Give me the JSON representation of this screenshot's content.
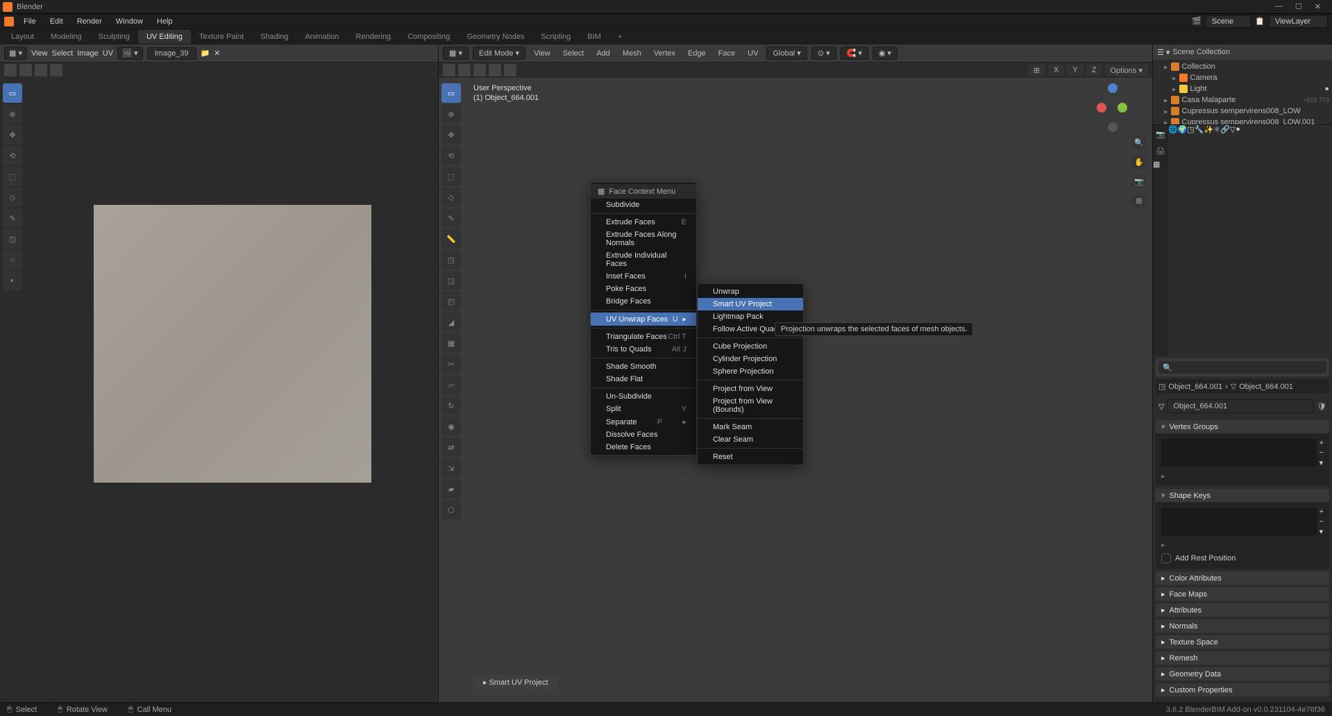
{
  "titlebar": {
    "title": "Blender"
  },
  "menubar": {
    "items": [
      "File",
      "Edit",
      "Render",
      "Window",
      "Help"
    ],
    "scene_label": "Scene",
    "viewlayer_label": "ViewLayer"
  },
  "workspace_tabs": {
    "items": [
      "Layout",
      "Modeling",
      "Sculpting",
      "UV Editing",
      "Texture Paint",
      "Shading",
      "Animation",
      "Rendering",
      "Compositing",
      "Geometry Nodes",
      "Scripting",
      "BIM",
      "+"
    ],
    "active": "UV Editing"
  },
  "uv": {
    "header_items": [
      "View",
      "Select",
      "Image",
      "UV"
    ],
    "image_name": "Image_39"
  },
  "viewport": {
    "mode": "Edit Mode",
    "menus": [
      "View",
      "Select",
      "Add",
      "Mesh",
      "Vertex",
      "Edge",
      "Face",
      "UV"
    ],
    "orientation": "Global",
    "overlay": {
      "line1": "User Perspective",
      "line2": "(1) Object_664.001"
    },
    "xyz_btns": [
      "X",
      "Y",
      "Z"
    ],
    "options_label": "Options",
    "status_label": "Smart UV Project"
  },
  "context_menu": {
    "title": "Face Context Menu",
    "items": [
      {
        "label": "Subdivide"
      },
      {
        "sep": true
      },
      {
        "label": "Extrude Faces",
        "shortcut": "E"
      },
      {
        "label": "Extrude Faces Along Normals"
      },
      {
        "label": "Extrude Individual Faces"
      },
      {
        "label": "Inset Faces",
        "shortcut": "I"
      },
      {
        "label": "Poke Faces"
      },
      {
        "label": "Bridge Faces"
      },
      {
        "sep": true
      },
      {
        "label": "UV Unwrap Faces",
        "shortcut": "U",
        "submenu": true,
        "hover": true
      },
      {
        "sep": true
      },
      {
        "label": "Triangulate Faces",
        "shortcut": "Ctrl T"
      },
      {
        "label": "Tris to Quads",
        "shortcut": "Alt J"
      },
      {
        "sep": true
      },
      {
        "label": "Shade Smooth"
      },
      {
        "label": "Shade Flat"
      },
      {
        "sep": true
      },
      {
        "label": "Un-Subdivide"
      },
      {
        "label": "Split",
        "shortcut": "Y"
      },
      {
        "label": "Separate",
        "shortcut": "P",
        "submenu": true
      },
      {
        "label": "Dissolve Faces"
      },
      {
        "label": "Delete Faces"
      }
    ]
  },
  "submenu": {
    "items": [
      {
        "label": "Unwrap"
      },
      {
        "label": "Smart UV Project",
        "hover": true
      },
      {
        "label": "Lightmap Pack"
      },
      {
        "label": "Follow Active Quads"
      },
      {
        "sep": true
      },
      {
        "label": "Cube Projection"
      },
      {
        "label": "Cylinder Projection"
      },
      {
        "label": "Sphere Projection"
      },
      {
        "sep": true
      },
      {
        "label": "Project from View"
      },
      {
        "label": "Project from View (Bounds)"
      },
      {
        "sep": true
      },
      {
        "label": "Mark Seam"
      },
      {
        "label": "Clear Seam"
      },
      {
        "sep": true
      },
      {
        "label": "Reset"
      }
    ]
  },
  "tooltip": "Projection unwraps the selected faces of mesh objects.",
  "outliner": {
    "header": "Scene Collection",
    "items": [
      {
        "name": "Collection",
        "indent": 1
      },
      {
        "name": "Camera",
        "indent": 2
      },
      {
        "name": "Light",
        "indent": 2
      },
      {
        "name": "Casa Malaparte",
        "indent": 1,
        "count": "+815 773"
      },
      {
        "name": "Cupressus sempervirens008_LOW",
        "indent": 1
      },
      {
        "name": "Cupressus sempervirens008_LOW.001",
        "indent": 1
      }
    ]
  },
  "properties": {
    "breadcrumb": [
      "Object_664.001",
      "Object_664.001"
    ],
    "object_name": "Object_664.001",
    "panels": {
      "vertex_groups": "Vertex Groups",
      "shape_keys": "Shape Keys",
      "add_rest": "Add Rest Position",
      "collapsed": [
        "Color Attributes",
        "Face Maps",
        "Attributes",
        "Normals",
        "Texture Space",
        "Remesh",
        "Geometry Data",
        "Custom Properties"
      ]
    }
  },
  "statusbar": {
    "select": "Select",
    "rotate": "Rotate View",
    "menu": "Call Menu",
    "version": "3.6.2    BlenderBIM Add-on v0.0.231104-4e76f36"
  }
}
